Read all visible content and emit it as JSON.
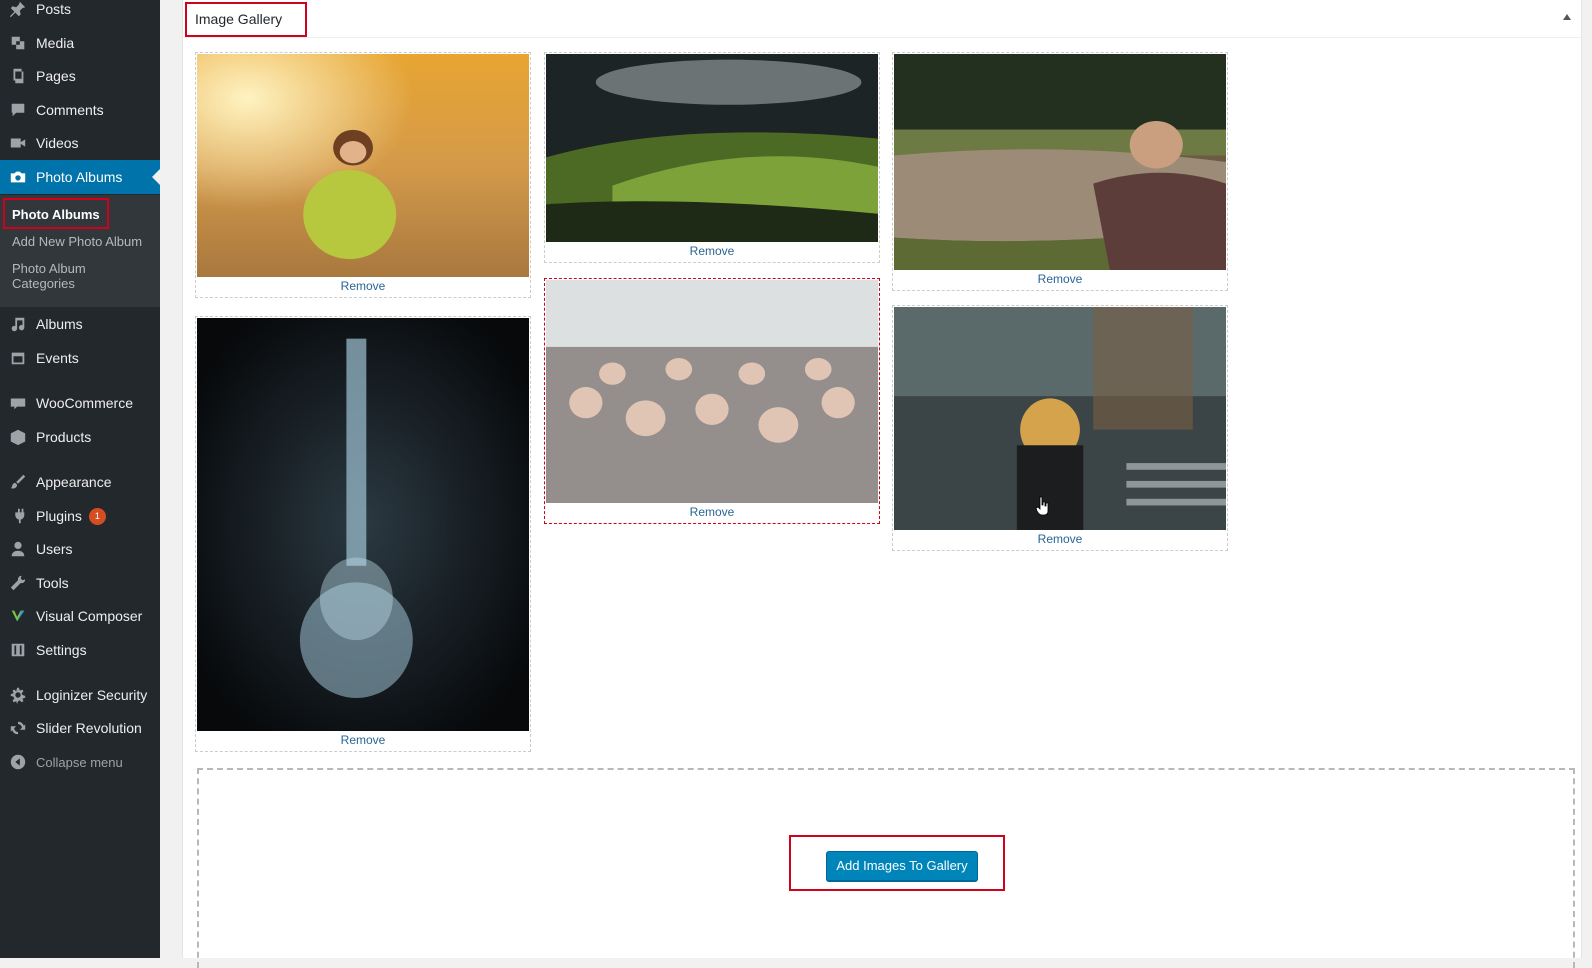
{
  "sidebar": {
    "items": [
      {
        "label": "Posts",
        "icon": "pushpin-icon"
      },
      {
        "label": "Media",
        "icon": "media-icon"
      },
      {
        "label": "Pages",
        "icon": "pages-icon"
      },
      {
        "label": "Comments",
        "icon": "comment-icon"
      },
      {
        "label": "Videos",
        "icon": "video-camera-icon"
      },
      {
        "label": "Photo Albums",
        "icon": "camera-icon"
      },
      {
        "label": "Albums",
        "icon": "music-note-icon"
      },
      {
        "label": "Events",
        "icon": "calendar-icon"
      },
      {
        "label": "WooCommerce",
        "icon": "woocommerce-icon"
      },
      {
        "label": "Products",
        "icon": "box-icon"
      },
      {
        "label": "Appearance",
        "icon": "paintbrush-icon"
      },
      {
        "label": "Plugins",
        "icon": "plug-icon",
        "badge": "1"
      },
      {
        "label": "Users",
        "icon": "user-icon"
      },
      {
        "label": "Tools",
        "icon": "wrench-icon"
      },
      {
        "label": "Visual Composer",
        "icon": "visual-composer-icon"
      },
      {
        "label": "Settings",
        "icon": "settings-sliders-icon"
      },
      {
        "label": "Loginizer Security",
        "icon": "gear-icon"
      },
      {
        "label": "Slider Revolution",
        "icon": "refresh-icon"
      }
    ],
    "submenu": [
      {
        "label": "Photo Albums"
      },
      {
        "label": "Add New Photo Album"
      },
      {
        "label": "Photo Album Categories"
      }
    ],
    "collapse_label": "Collapse menu"
  },
  "panel": {
    "title": "Image Gallery",
    "remove_label": "Remove",
    "add_button_label": "Add Images To Gallery"
  },
  "colors": {
    "sidebar_bg": "#23282d",
    "active_bg": "#0073aa",
    "button_bg": "#0085ba",
    "highlight_red": "#d0021b"
  }
}
